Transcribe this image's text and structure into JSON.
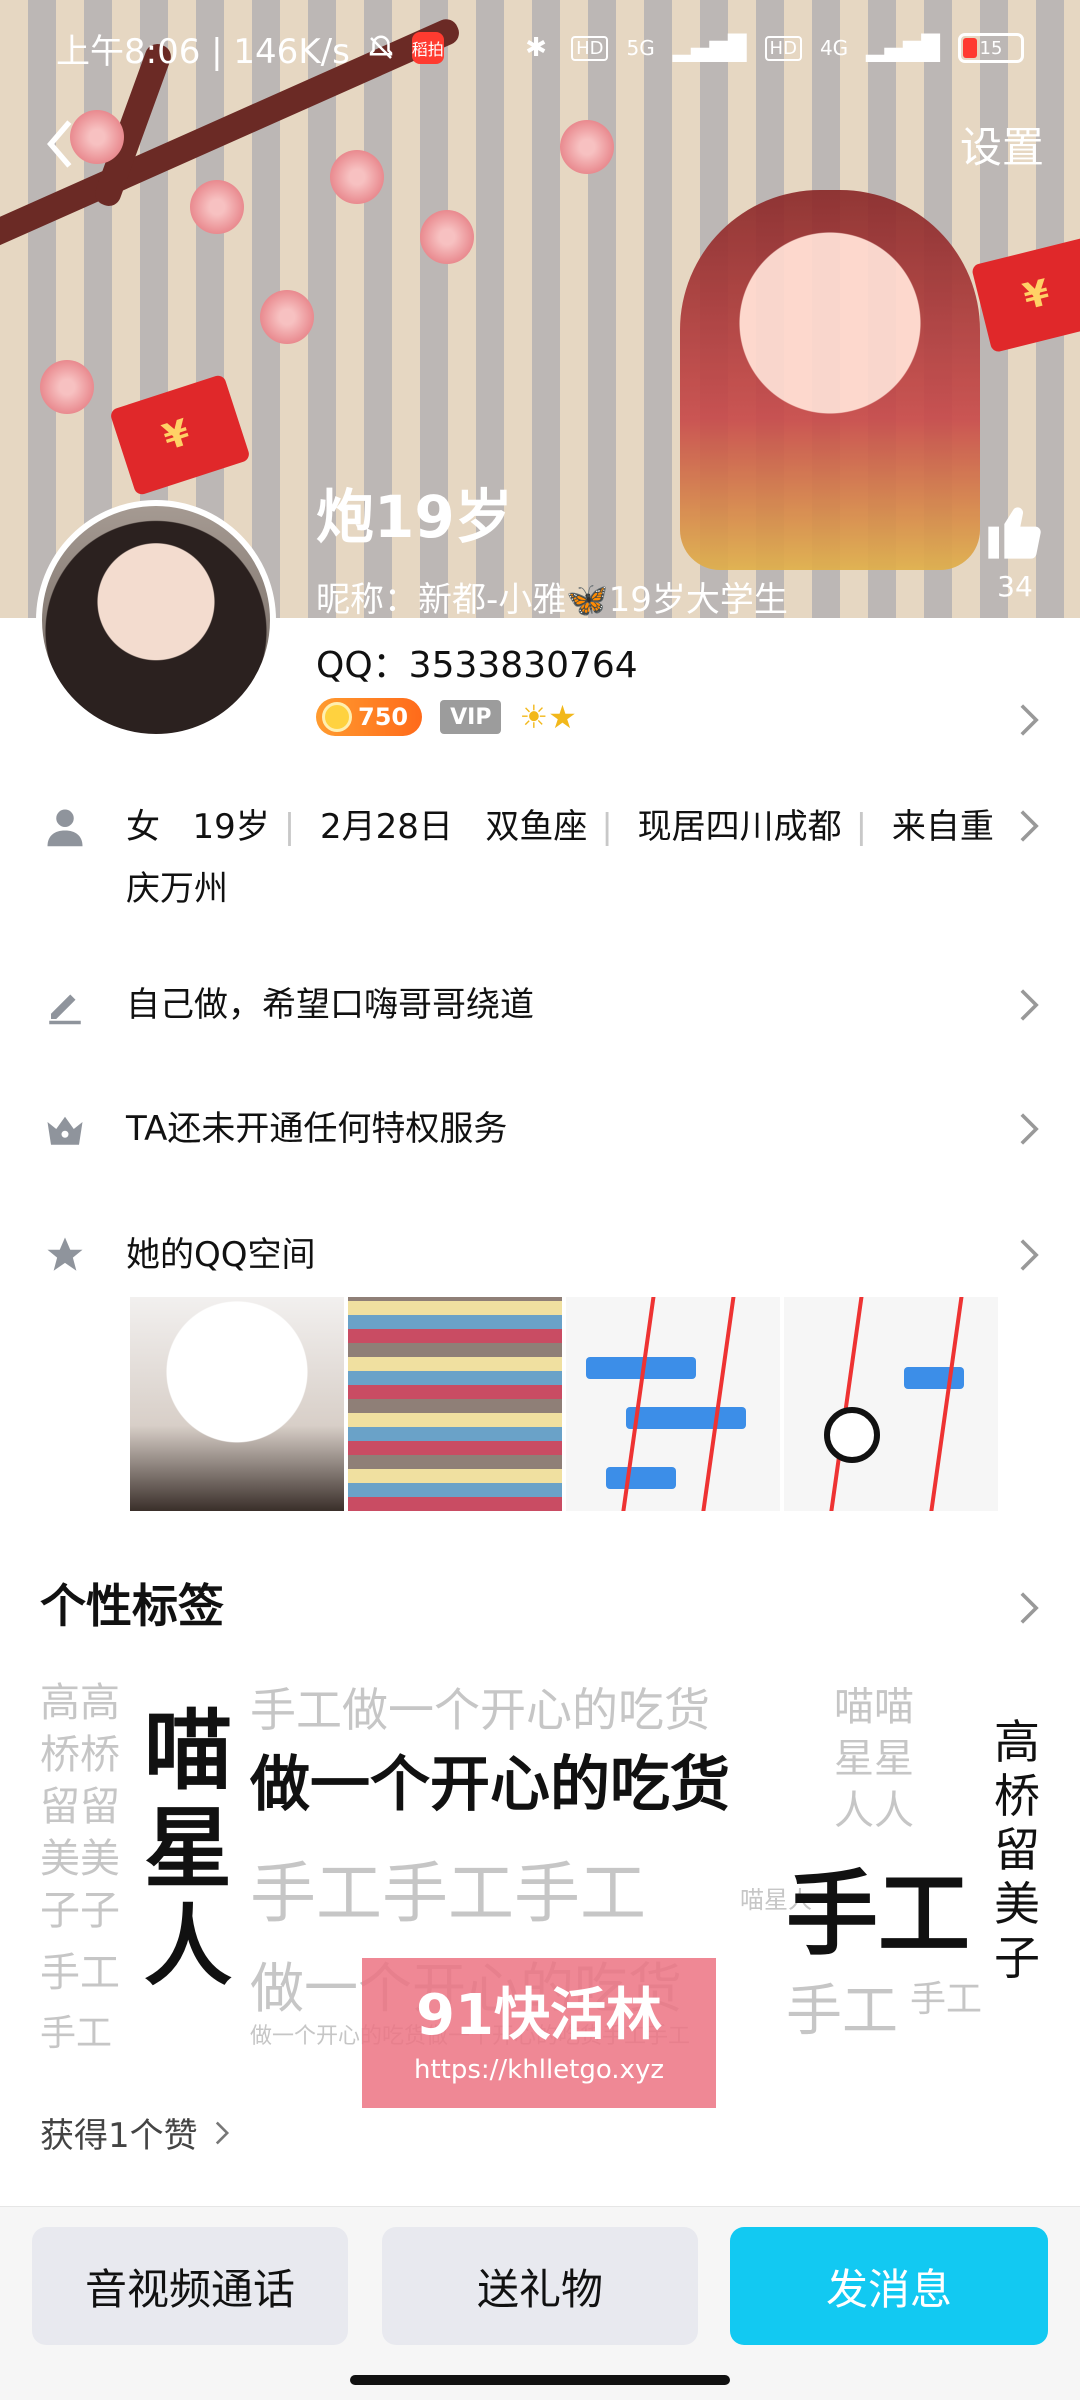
{
  "status_bar": {
    "time_speed": "上午8:06 | 146K/s",
    "notif_badge": "稻拍",
    "signal_5g": "5G",
    "signal_4g": "4G",
    "hd1": "HD",
    "hd2": "HD",
    "battery": "15"
  },
  "nav": {
    "settings": "设置"
  },
  "profile": {
    "name": "炮19岁",
    "nickname": "昵称：新都-小雅🦋19岁大学生",
    "likes": "34",
    "qq": "QQ：3533830764",
    "coin_level": "750",
    "vip": "VIP",
    "level_icons": "☀★"
  },
  "info": {
    "gender": "女",
    "age": "19岁",
    "birthday": "2月28日",
    "zodiac": "双鱼座",
    "location": "现居四川成都",
    "hometown": "来自重庆万州",
    "signature": "自己做，希望口嗨哥哥绕道",
    "privilege": "TA还未开通任何特权服务",
    "qzone": "她的QQ空间"
  },
  "tags_section": {
    "title": "个性标签",
    "tags": {
      "t1": "高高",
      "t2": "桥桥",
      "t3": "留留",
      "t4": "美美",
      "t5": "子子",
      "t6": "手工做一个开心的吃货",
      "t7": "喵",
      "t8": "星",
      "t9": "人",
      "t10": "做一个开心的吃货",
      "t11": "手工手工手工",
      "t12": "做一个开心的吃货",
      "t13": "手工",
      "t14": "手工",
      "t15": "喵喵",
      "t16": "星星",
      "t17": "人人",
      "t18": "手工",
      "t19": "高",
      "t20": "桥",
      "t21": "留",
      "t22": "美",
      "t23": "子",
      "t24": "手工",
      "t25": "手工",
      "t26": "喵星人",
      "t27": "做一个开心的吃货做一个开心的吃货手工手工"
    }
  },
  "watermark": {
    "brand": "91快活林",
    "url": "https://khlletgo.xyz"
  },
  "likes_got": "获得1个赞",
  "actions": {
    "call": "音视频通话",
    "gift": "送礼物",
    "message": "发消息"
  },
  "colors": {
    "accent_blue": "#12c9f2",
    "coin_orange": "#ff7a1f",
    "vip_gray": "#9c9c9c"
  }
}
